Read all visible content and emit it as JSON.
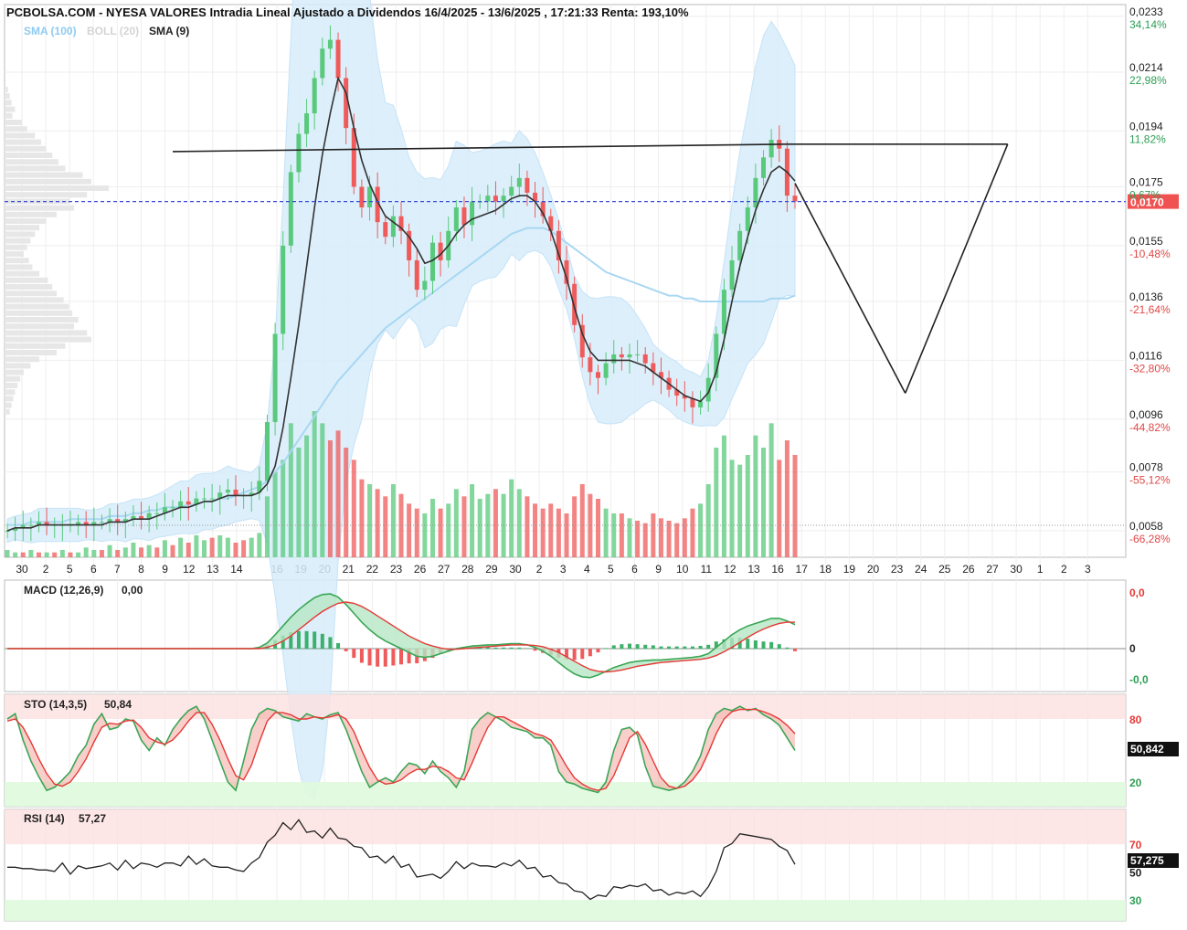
{
  "header": {
    "title": "PCBOLSA.COM - NYESA VALORES Intradia Lineal Ajustado a Dividendos 16/4/2025 - 13/6/2025 , 17:21:33 Renta: 193,10%",
    "legend_sma100": "SMA (100)",
    "legend_boll": "BOLL (20)",
    "legend_sma9": "SMA (9)"
  },
  "colors": {
    "up": "#59c97c",
    "down": "#ef5b5b",
    "sma100": "#a9d7f2",
    "boll_fill": "#d6ecfa",
    "sma9": "#333333",
    "price_line": "#3a4bd6",
    "last_price_bg": "#f05252",
    "green_text": "#2e9e55",
    "red_text": "#e04848"
  },
  "chart_data": [
    {
      "type": "line",
      "title": "PCBOLSA.COM - NYESA VALORES Intradia Lineal Ajustado a Dividendos 16/4/2025 - 13/6/2025 , 17:21:33 Renta: 193,10%",
      "y_ticks": [
        {
          "value": "0,0233",
          "pct": "34,14%",
          "pct_dir": "up"
        },
        {
          "value": "0,0214",
          "pct": "22,98%",
          "pct_dir": "up"
        },
        {
          "value": "0,0194",
          "pct": "11,82%",
          "pct_dir": "up"
        },
        {
          "value": "0,0175",
          "pct": "0,67%",
          "pct_dir": "up"
        },
        {
          "value": "0,0155",
          "pct": "-10,48%",
          "pct_dir": "down"
        },
        {
          "value": "0,0136",
          "pct": "-21,64%",
          "pct_dir": "down"
        },
        {
          "value": "0,0116",
          "pct": "-32,80%",
          "pct_dir": "down"
        },
        {
          "value": "0,0096",
          "pct": "-44,82%",
          "pct_dir": "down"
        },
        {
          "value": "0,0078",
          "pct": "-55,12%",
          "pct_dir": "down"
        },
        {
          "value": "0,0058",
          "pct": "-66,28%",
          "pct_dir": "down"
        }
      ],
      "last_price": "0,0170",
      "x_labels": [
        "30",
        "2",
        "5",
        "6",
        "7",
        "8",
        "9",
        "12",
        "13",
        "14",
        "16",
        "19",
        "20",
        "21",
        "22",
        "23",
        "26",
        "27",
        "28",
        "29",
        "30",
        "2",
        "3",
        "4",
        "5",
        "6",
        "9",
        "10",
        "11",
        "12",
        "13",
        "16",
        "17",
        "18",
        "19",
        "20",
        "23",
        "24",
        "25",
        "26",
        "27",
        "30",
        "1",
        "2",
        "3"
      ],
      "ylim": [
        0.0049,
        0.0237
      ],
      "close": [
        0.0058,
        0.0059,
        0.006,
        0.006,
        0.0061,
        0.006,
        0.006,
        0.006,
        0.006,
        0.0061,
        0.006,
        0.0061,
        0.0061,
        0.0062,
        0.0061,
        0.0062,
        0.0063,
        0.0062,
        0.0064,
        0.0064,
        0.0066,
        0.0066,
        0.0068,
        0.0067,
        0.0069,
        0.0069,
        0.0069,
        0.0071,
        0.0072,
        0.007,
        0.007,
        0.0071,
        0.0075,
        0.0095,
        0.0125,
        0.0155,
        0.018,
        0.0193,
        0.02,
        0.0212,
        0.0222,
        0.0225,
        0.0212,
        0.0195,
        0.0175,
        0.0168,
        0.0175,
        0.0163,
        0.0158,
        0.0165,
        0.016,
        0.015,
        0.014,
        0.0143,
        0.0156,
        0.015,
        0.016,
        0.0168,
        0.0162,
        0.017,
        0.017,
        0.0172,
        0.017,
        0.0172,
        0.0175,
        0.0178,
        0.0173,
        0.017,
        0.0165,
        0.016,
        0.015,
        0.0142,
        0.0128,
        0.0117,
        0.0112,
        0.011,
        0.0115,
        0.0118,
        0.0117,
        0.0118,
        0.0118,
        0.0115,
        0.0112,
        0.011,
        0.0106,
        0.0104,
        0.0103,
        0.01,
        0.0102,
        0.011,
        0.0125,
        0.014,
        0.015,
        0.016,
        0.0168,
        0.0178,
        0.0185,
        0.0191,
        0.0188,
        0.0172,
        0.017
      ],
      "sma9": [
        0.0058,
        0.0059,
        0.0059,
        0.0059,
        0.006,
        0.006,
        0.006,
        0.006,
        0.006,
        0.006,
        0.006,
        0.006,
        0.006,
        0.0061,
        0.0061,
        0.0061,
        0.0062,
        0.0062,
        0.0062,
        0.0063,
        0.0064,
        0.0065,
        0.0066,
        0.0066,
        0.0067,
        0.0068,
        0.0068,
        0.0069,
        0.007,
        0.007,
        0.007,
        0.007,
        0.0071,
        0.0074,
        0.008,
        0.0093,
        0.011,
        0.0128,
        0.0148,
        0.0168,
        0.0186,
        0.02,
        0.0212,
        0.0207,
        0.0195,
        0.0184,
        0.0176,
        0.017,
        0.0165,
        0.0163,
        0.0161,
        0.0158,
        0.0154,
        0.0149,
        0.015,
        0.0152,
        0.0155,
        0.0159,
        0.0162,
        0.0164,
        0.0165,
        0.0166,
        0.0167,
        0.0169,
        0.0171,
        0.0172,
        0.0172,
        0.017,
        0.0166,
        0.016,
        0.0152,
        0.0144,
        0.0134,
        0.0125,
        0.0119,
        0.0116,
        0.0116,
        0.0116,
        0.0116,
        0.0116,
        0.0115,
        0.0114,
        0.0112,
        0.011,
        0.0108,
        0.0106,
        0.0104,
        0.0103,
        0.0102,
        0.0105,
        0.0112,
        0.0123,
        0.0136,
        0.0148,
        0.0158,
        0.0167,
        0.0174,
        0.018,
        0.0182,
        0.018,
        0.0177
      ],
      "sma100": [
        0.006,
        0.006,
        0.006,
        0.0061,
        0.0061,
        0.0061,
        0.0061,
        0.0061,
        0.0062,
        0.0062,
        0.0062,
        0.0062,
        0.0062,
        0.0063,
        0.0063,
        0.0063,
        0.0064,
        0.0064,
        0.0065,
        0.0065,
        0.0066,
        0.0066,
        0.0066,
        0.0067,
        0.0067,
        0.0068,
        0.0068,
        0.0069,
        0.0069,
        0.007,
        0.0071,
        0.0072,
        0.0073,
        0.0075,
        0.0078,
        0.0081,
        0.0085,
        0.0089,
        0.0093,
        0.0097,
        0.0101,
        0.0105,
        0.0109,
        0.0112,
        0.0115,
        0.0118,
        0.0121,
        0.0124,
        0.0127,
        0.0129,
        0.0131,
        0.0133,
        0.0135,
        0.0137,
        0.0139,
        0.0141,
        0.0143,
        0.0145,
        0.0147,
        0.0149,
        0.0151,
        0.0153,
        0.0155,
        0.0157,
        0.0159,
        0.016,
        0.0161,
        0.0161,
        0.0161,
        0.016,
        0.0158,
        0.0156,
        0.0154,
        0.0152,
        0.015,
        0.0148,
        0.0146,
        0.0145,
        0.0144,
        0.0143,
        0.0142,
        0.0141,
        0.014,
        0.0139,
        0.0138,
        0.0138,
        0.0137,
        0.0137,
        0.0136,
        0.0136,
        0.0136,
        0.0136,
        0.0136,
        0.0136,
        0.0136,
        0.0136,
        0.0136,
        0.0137,
        0.0137,
        0.0137,
        0.0138
      ],
      "volume": [
        3,
        2,
        2,
        3,
        2,
        2,
        2,
        3,
        2,
        2,
        4,
        3,
        3,
        5,
        3,
        4,
        6,
        4,
        5,
        4,
        7,
        5,
        8,
        6,
        9,
        7,
        8,
        9,
        8,
        6,
        7,
        8,
        10,
        25,
        35,
        40,
        55,
        45,
        50,
        60,
        55,
        48,
        52,
        45,
        40,
        32,
        30,
        28,
        25,
        30,
        26,
        22,
        20,
        18,
        24,
        20,
        22,
        28,
        25,
        30,
        24,
        26,
        28,
        26,
        32,
        28,
        25,
        22,
        20,
        22,
        20,
        18,
        25,
        30,
        26,
        24,
        20,
        18,
        18,
        16,
        15,
        14,
        18,
        16,
        15,
        14,
        16,
        20,
        22,
        30,
        45,
        50,
        40,
        38,
        42,
        50,
        45,
        55,
        40,
        48,
        42
      ],
      "volume_dir": [
        1,
        1,
        0,
        1,
        0,
        1,
        0,
        1,
        0,
        1,
        1,
        1,
        0,
        1,
        0,
        1,
        1,
        0,
        1,
        0,
        1,
        0,
        1,
        0,
        1,
        1,
        0,
        1,
        1,
        0,
        0,
        1,
        1,
        1,
        1,
        1,
        1,
        1,
        1,
        1,
        1,
        0,
        0,
        0,
        0,
        0,
        1,
        0,
        0,
        1,
        0,
        0,
        0,
        1,
        1,
        0,
        1,
        1,
        0,
        1,
        1,
        1,
        0,
        1,
        1,
        1,
        0,
        0,
        0,
        0,
        0,
        0,
        0,
        0,
        0,
        0,
        1,
        1,
        0,
        1,
        0,
        0,
        0,
        0,
        0,
        0,
        0,
        0,
        1,
        1,
        1,
        1,
        1,
        1,
        1,
        1,
        1,
        1,
        0,
        0,
        0
      ],
      "annotation": "hand-drawn pattern lines (neckline + projected V)"
    },
    {
      "type": "line",
      "title": "MACD (12,26,9)",
      "value": "0,00",
      "y_ticks": [
        "0,0",
        "0",
        "-0,0"
      ],
      "macd": [
        0,
        0,
        0,
        0,
        0,
        0,
        0,
        0,
        0,
        0,
        0,
        0,
        0,
        0,
        0,
        0,
        0,
        0,
        0,
        0,
        0,
        0,
        0,
        0,
        0,
        0,
        0,
        0,
        0,
        0,
        0,
        0,
        0.2,
        0.9,
        2.2,
        3.6,
        5.0,
        6.2,
        7.2,
        8.1,
        8.6,
        8.7,
        8.2,
        7.0,
        5.6,
        4.2,
        3.0,
        2.0,
        1.2,
        0.6,
        0.0,
        -0.6,
        -1.2,
        -1.4,
        -1.2,
        -0.8,
        -0.4,
        0.0,
        0.2,
        0.4,
        0.5,
        0.6,
        0.6,
        0.7,
        0.8,
        0.8,
        0.6,
        0.2,
        -0.4,
        -1.2,
        -2.2,
        -3.2,
        -4.0,
        -4.5,
        -4.6,
        -4.2,
        -3.6,
        -3.0,
        -2.6,
        -2.2,
        -2.0,
        -1.9,
        -1.8,
        -1.8,
        -1.7,
        -1.6,
        -1.5,
        -1.4,
        -1.2,
        -0.8,
        0.2,
        1.2,
        2.2,
        3.0,
        3.6,
        4.0,
        4.4,
        4.8,
        4.8,
        4.4,
        3.8
      ],
      "signal": [
        0,
        0,
        0,
        0,
        0,
        0,
        0,
        0,
        0,
        0,
        0,
        0,
        0,
        0,
        0,
        0,
        0,
        0,
        0,
        0,
        0,
        0,
        0,
        0,
        0,
        0,
        0,
        0,
        0,
        0,
        0,
        0,
        0.0,
        0.2,
        0.6,
        1.2,
        2.0,
        3.0,
        4.0,
        5.0,
        5.9,
        6.6,
        7.2,
        7.4,
        7.2,
        6.7,
        6.0,
        5.2,
        4.4,
        3.6,
        2.8,
        2.0,
        1.4,
        0.8,
        0.4,
        0.1,
        -0.1,
        -0.1,
        0.0,
        0.1,
        0.2,
        0.3,
        0.4,
        0.5,
        0.6,
        0.6,
        0.6,
        0.5,
        0.3,
        -0.1,
        -0.6,
        -1.3,
        -2.0,
        -2.7,
        -3.3,
        -3.6,
        -3.7,
        -3.6,
        -3.4,
        -3.1,
        -2.8,
        -2.6,
        -2.4,
        -2.2,
        -2.1,
        -2.0,
        -1.9,
        -1.8,
        -1.7,
        -1.5,
        -1.1,
        -0.5,
        0.2,
        1.0,
        1.8,
        2.5,
        3.1,
        3.6,
        4.0,
        4.2,
        4.2
      ]
    },
    {
      "type": "line",
      "title": "STO (14,3,5)",
      "value": "50,84",
      "last_value": "50,842",
      "y_ticks": [
        "80",
        "20"
      ],
      "k": [
        80,
        85,
        60,
        40,
        25,
        12,
        15,
        22,
        30,
        45,
        55,
        75,
        85,
        70,
        72,
        80,
        78,
        60,
        50,
        62,
        55,
        70,
        80,
        88,
        92,
        80,
        60,
        40,
        20,
        12,
        40,
        70,
        85,
        90,
        88,
        82,
        80,
        78,
        85,
        82,
        80,
        84,
        86,
        70,
        50,
        30,
        15,
        20,
        24,
        20,
        30,
        38,
        36,
        28,
        40,
        30,
        24,
        15,
        30,
        70,
        80,
        86,
        82,
        78,
        72,
        70,
        68,
        62,
        62,
        55,
        30,
        20,
        18,
        14,
        12,
        10,
        20,
        50,
        70,
        72,
        65,
        35,
        16,
        14,
        12,
        14,
        20,
        30,
        45,
        70,
        85,
        90,
        88,
        92,
        88,
        90,
        84,
        80,
        74,
        62,
        50
      ],
      "d": [
        78,
        80,
        72,
        58,
        42,
        28,
        18,
        16,
        20,
        30,
        42,
        58,
        72,
        76,
        75,
        78,
        79,
        72,
        62,
        58,
        56,
        60,
        68,
        78,
        86,
        86,
        75,
        60,
        42,
        26,
        22,
        36,
        58,
        78,
        86,
        86,
        84,
        80,
        80,
        82,
        81,
        82,
        84,
        80,
        68,
        50,
        34,
        22,
        18,
        19,
        22,
        28,
        32,
        32,
        35,
        34,
        30,
        24,
        22,
        38,
        56,
        72,
        82,
        82,
        78,
        74,
        70,
        66,
        64,
        60,
        48,
        35,
        24,
        18,
        14,
        12,
        14,
        26,
        44,
        62,
        68,
        56,
        40,
        24,
        16,
        14,
        16,
        22,
        32,
        48,
        66,
        80,
        87,
        89,
        89,
        89,
        87,
        84,
        80,
        74,
        66
      ]
    },
    {
      "type": "line",
      "title": "RSI (14)",
      "value": "57,27",
      "last_value": "57,275",
      "y_ticks": [
        "70",
        "50",
        "30"
      ],
      "rsi": [
        55,
        52,
        54,
        51,
        53,
        50,
        52,
        55,
        50,
        53,
        54,
        52,
        56,
        55,
        53,
        57,
        54,
        55,
        57,
        52,
        58,
        55,
        56,
        60,
        57,
        58,
        56,
        52,
        55,
        50,
        52,
        55,
        62,
        70,
        78,
        84,
        82,
        86,
        80,
        78,
        76,
        80,
        76,
        72,
        70,
        66,
        62,
        60,
        58,
        60,
        55,
        54,
        48,
        46,
        50,
        44,
        52,
        56,
        54,
        55,
        56,
        53,
        55,
        55,
        56,
        57,
        54,
        52,
        48,
        46,
        44,
        40,
        38,
        34,
        32,
        32,
        34,
        38,
        40,
        39,
        41,
        40,
        38,
        36,
        35,
        34,
        36,
        35,
        34,
        38,
        52,
        66,
        72,
        76,
        78,
        74,
        76,
        72,
        70,
        64,
        57
      ]
    }
  ],
  "pattern_lines": [
    {
      "from": [
        21,
        0.0187
      ],
      "to": [
        99,
        0.01895
      ]
    },
    {
      "from": [
        99,
        0.01895
      ],
      "to": [
        127,
        0.01895
      ]
    },
    {
      "from": [
        100,
        0.01762
      ],
      "to": [
        114,
        0.01048
      ]
    },
    {
      "from": [
        114,
        0.01048
      ],
      "to": [
        127,
        0.01895
      ]
    }
  ]
}
